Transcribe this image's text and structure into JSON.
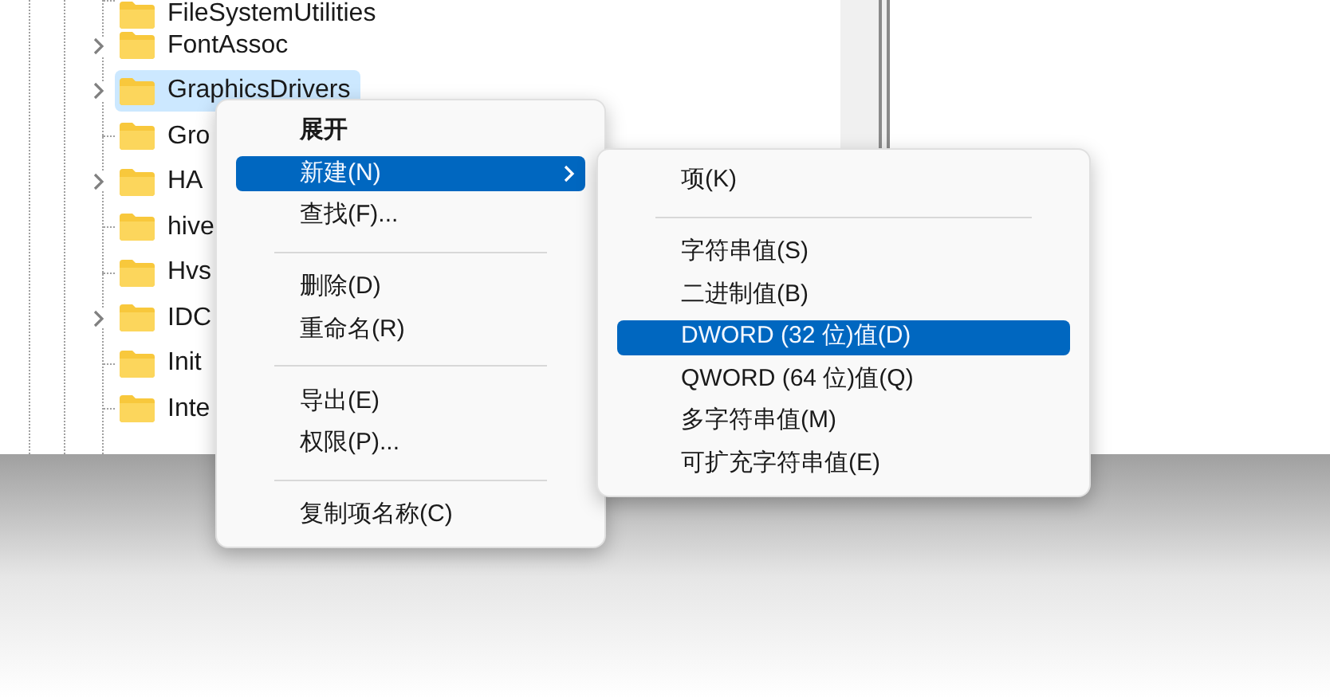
{
  "tree": {
    "items": [
      {
        "label": "FileSystemUtilities",
        "expandable": false,
        "selected": false
      },
      {
        "label": "FontAssoc",
        "expandable": true,
        "selected": false
      },
      {
        "label": "GraphicsDrivers",
        "expandable": true,
        "selected": true
      },
      {
        "label": "Gro",
        "expandable": false,
        "selected": false
      },
      {
        "label": "HA",
        "expandable": true,
        "selected": false
      },
      {
        "label": "hive",
        "expandable": false,
        "selected": false
      },
      {
        "label": "Hvs",
        "expandable": false,
        "selected": false
      },
      {
        "label": "IDC",
        "expandable": true,
        "selected": false
      },
      {
        "label": "Init",
        "expandable": false,
        "selected": false
      },
      {
        "label": "Inte",
        "expandable": false,
        "selected": false
      }
    ]
  },
  "context_menu": {
    "items": [
      {
        "kind": "item",
        "label": "展开",
        "default": true,
        "selected": false,
        "submenu": false
      },
      {
        "kind": "item",
        "label": "新建(N)",
        "default": false,
        "selected": true,
        "submenu": true
      },
      {
        "kind": "item",
        "label": "查找(F)...",
        "default": false,
        "selected": false,
        "submenu": false
      },
      {
        "kind": "separator"
      },
      {
        "kind": "item",
        "label": "删除(D)",
        "default": false,
        "selected": false,
        "submenu": false
      },
      {
        "kind": "item",
        "label": "重命名(R)",
        "default": false,
        "selected": false,
        "submenu": false
      },
      {
        "kind": "separator"
      },
      {
        "kind": "item",
        "label": "导出(E)",
        "default": false,
        "selected": false,
        "submenu": false
      },
      {
        "kind": "item",
        "label": "权限(P)...",
        "default": false,
        "selected": false,
        "submenu": false
      },
      {
        "kind": "separator"
      },
      {
        "kind": "item",
        "label": "复制项名称(C)",
        "default": false,
        "selected": false,
        "submenu": false
      }
    ]
  },
  "submenu": {
    "items": [
      {
        "kind": "item",
        "label": "项(K)",
        "selected": false
      },
      {
        "kind": "separator"
      },
      {
        "kind": "item",
        "label": "字符串值(S)",
        "selected": false
      },
      {
        "kind": "item",
        "label": "二进制值(B)",
        "selected": false
      },
      {
        "kind": "item",
        "label": "DWORD (32 位)值(D)",
        "selected": true
      },
      {
        "kind": "item",
        "label": "QWORD (64 位)值(Q)",
        "selected": false
      },
      {
        "kind": "item",
        "label": "多字符串值(M)",
        "selected": false
      },
      {
        "kind": "item",
        "label": "可扩充字符串值(E)",
        "selected": false
      }
    ]
  }
}
